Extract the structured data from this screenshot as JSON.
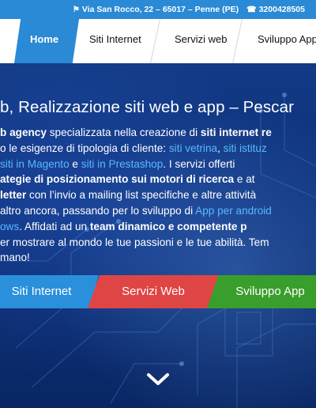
{
  "topbar": {
    "address": "Via San Rocco, 22 – 65017 – Penne (PE)",
    "phone": "3200428505",
    "address_icon": "map-marker-icon",
    "phone_icon": "phone-icon"
  },
  "nav": {
    "items": [
      {
        "label": "Home",
        "active": true
      },
      {
        "label": "Siti Internet",
        "active": false
      },
      {
        "label": "Servizi web",
        "active": false
      },
      {
        "label": "Sviluppo App",
        "active": false
      }
    ]
  },
  "hero": {
    "title": "b, Realizzazione siti web e app – Pescar",
    "para": {
      "l1_a": "b agency",
      "l1_b": " specializzata nella creazione di ",
      "l1_c": "siti internet re",
      "l2_a": "o le esigenze di tipologia di cliente: ",
      "l2_b": "siti vetrina",
      "l2_c": ", ",
      "l2_d": "siti istituz",
      "l3_a": "siti in Magento",
      "l3_b": " e ",
      "l3_c": "siti in Prestashop",
      "l3_d": ". I servizi offerti",
      "l4_a": "ategie di posizionamento sui motori di ricerca",
      "l4_b": " e at",
      "l5_a": "letter",
      "l5_b": " con l’invio a mailing list specifiche e altre attività",
      "l6_a": "altro ancora, passando per lo sviluppo di ",
      "l6_b": "App per android",
      "l7_a": "ows",
      "l7_b": ". Affidati ad un ",
      "l7_c": "team dinamico e competente p",
      "l8": "er mostrare al mondo le tue passioni e le tue abilità. Tem",
      "l9": "mano!"
    },
    "buttons": {
      "siti": "Siti Internet",
      "servizi": "Servizi Web",
      "app": "Sviluppo App"
    },
    "scroll_icon": "chevron-down-icon"
  },
  "colors": {
    "accent_blue": "#2a8ad6",
    "button_red": "#e04545",
    "button_green": "#3a9e2c",
    "link": "#58b8ff"
  }
}
